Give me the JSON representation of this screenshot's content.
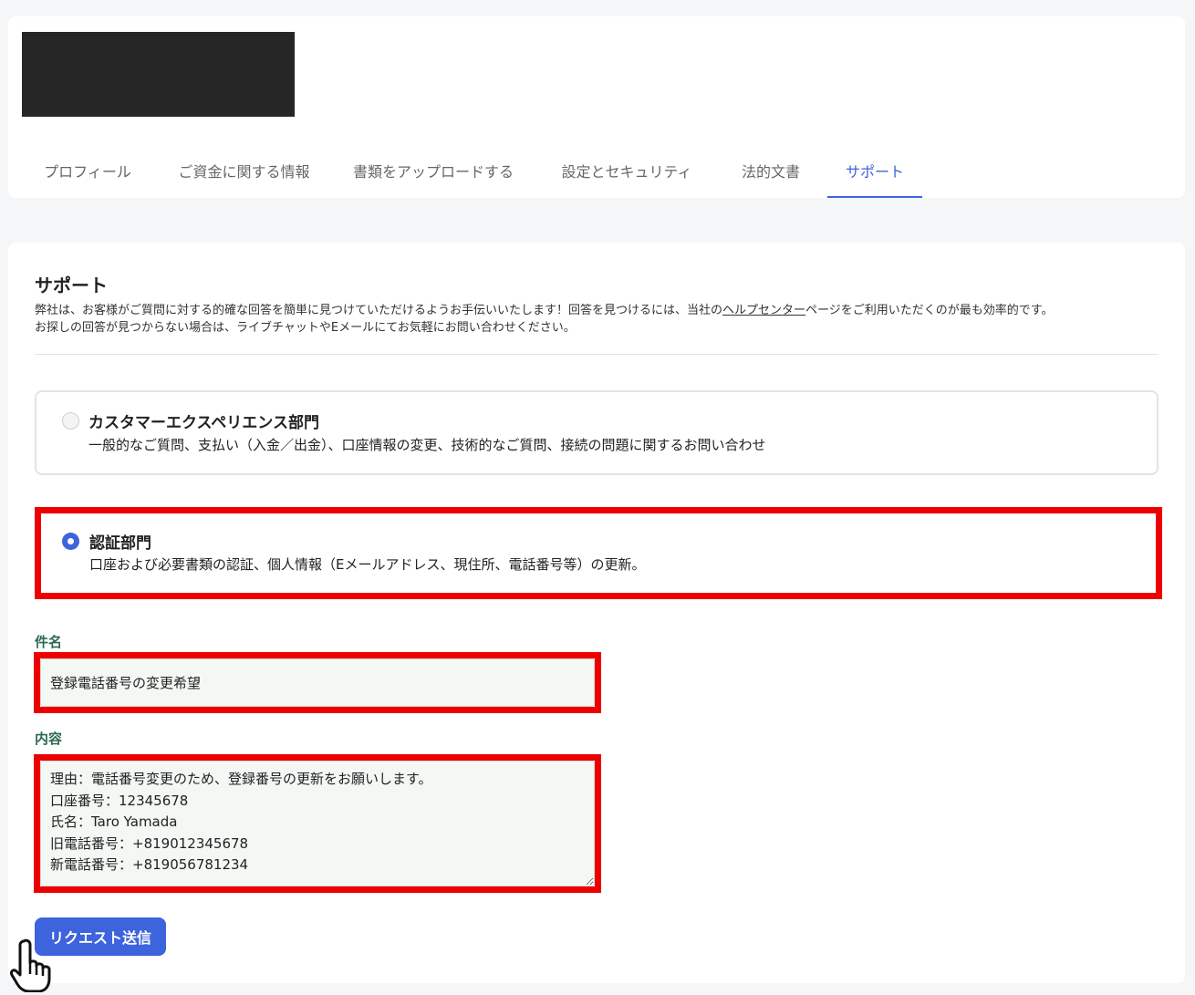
{
  "tabs": [
    {
      "label": "プロフィール"
    },
    {
      "label": "ご資金に関する情報"
    },
    {
      "label": "書類をアップロードする"
    },
    {
      "label": "設定とセキュリティ"
    },
    {
      "label": "法的文書"
    },
    {
      "label": "サポート",
      "active": true
    }
  ],
  "support": {
    "title": "サポート",
    "desc_pre": "弊社は、お客様がご質問に対する的確な回答を簡単に見つけていただけるようお手伝いいたします！回答を見つけるには、当社の",
    "help_link": "ヘルプセンター",
    "desc_post": "ページをご利用いただくのが最も効率的です。",
    "desc_line2": "お探しの回答が見つからない場合は、ライブチャットやEメールにてお気軽にお問い合わせください。"
  },
  "options": [
    {
      "title": "カスタマーエクスペリエンス部門",
      "text": "一般的なご質問、支払い（入金／出金）、口座情報の変更、技術的なご質問、接続の問題に関するお問い合わせ",
      "selected": false
    },
    {
      "title": "認証部門",
      "text": "口座および必要書類の認証、個人情報（Eメールアドレス、現住所、電話番号等）の更新。",
      "selected": true
    }
  ],
  "form": {
    "subject_label": "件名",
    "subject_value": "登録電話番号の変更希望",
    "content_label": "内容",
    "content_value": "理由：電話番号変更のため、登録番号の更新をお願いします。\n口座番号：12345678\n氏名：Taro Yamada\n旧電話番号：+819012345678\n新電話番号：+819056781234",
    "submit_label": "リクエスト送信"
  },
  "colors": {
    "accent": "#3d63dd",
    "highlight": "#ee0000",
    "label_green": "#2d6a4f"
  }
}
